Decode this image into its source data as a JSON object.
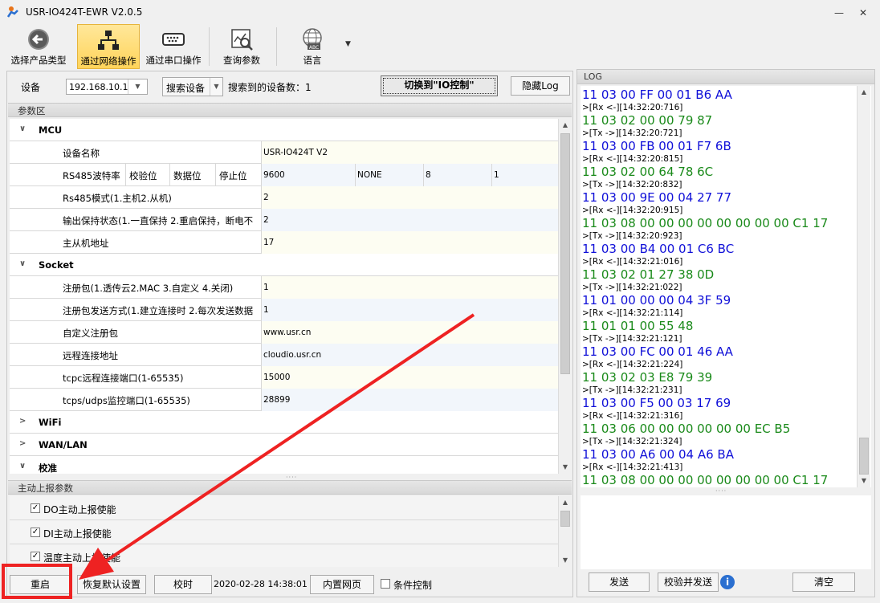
{
  "window": {
    "title": "USR-IO424T-EWR V2.0.5"
  },
  "toolbar": {
    "buttons": [
      {
        "label": "选择产品类型",
        "icon": "back-arrow-icon"
      },
      {
        "label": "通过网络操作",
        "icon": "network-icon",
        "active": true
      },
      {
        "label": "通过串口操作",
        "icon": "serial-port-icon"
      },
      {
        "label": "查询参数",
        "icon": "chart-search-icon"
      },
      {
        "label": "语言",
        "icon": "globe-abc-icon"
      }
    ]
  },
  "device_bar": {
    "device_label": "设备",
    "ip": "192.168.10.1",
    "search_button": "搜索设备",
    "found_count": "搜索到的设备数：1",
    "switch_button": "切换到\"IO控制\"",
    "hide_log_button": "隐藏Log"
  },
  "params": {
    "header": "参数区",
    "categories": {
      "mcu": "MCU",
      "socket": "Socket",
      "wifi": "WiFi",
      "wanlan": "WAN/LAN",
      "check": "校准"
    },
    "mcu_rows": [
      {
        "name": "设备名称",
        "value": "USR-IO424T V2"
      },
      {
        "name": "Rs485模式(1.主机2.从机)",
        "value": "2"
      },
      {
        "name": "输出保持状态(1.一直保持 2.重启保持，断电不",
        "value": "2"
      },
      {
        "name": "主从机地址",
        "value": "17"
      }
    ],
    "rs485": {
      "cols": [
        "RS485波特率",
        "校验位",
        "数据位",
        "停止位"
      ],
      "vals": [
        "9600",
        "NONE",
        "8",
        "1"
      ]
    },
    "socket_rows": [
      {
        "name": "注册包(1.透传云2.MAC 3.自定义 4.关闭)",
        "value": "1"
      },
      {
        "name": "注册包发送方式(1.建立连接时 2.每次发送数据",
        "value": "1"
      },
      {
        "name": "自定义注册包",
        "value": "www.usr.cn"
      },
      {
        "name": "远程连接地址",
        "value": "cloudio.usr.cn"
      },
      {
        "name": "tcpc远程连接端口(1-65535)",
        "value": "15000"
      },
      {
        "name": "tcps/udps监控端口(1-65535)",
        "value": "28899"
      }
    ]
  },
  "report": {
    "header": "主动上报参数",
    "items": [
      {
        "label": "DO主动上报使能",
        "checked": true
      },
      {
        "label": "DI主动上报使能",
        "checked": true
      },
      {
        "label": "温度主动上报使能",
        "checked": true
      }
    ]
  },
  "bottom": {
    "restart": "重启",
    "restore": "恢复默认设置",
    "sync_time": "校时",
    "datetime": "2020-02-28 14:38:01 5",
    "web": "内置网页",
    "cond_label": "条件控制"
  },
  "log": {
    "header": "LOG",
    "lines": [
      {
        "kind": "tx",
        "text": "11 03 00 FF 00 01 B6 AA"
      },
      {
        "kind": "ts",
        "text": ">[Rx <-][14:32:20:716]"
      },
      {
        "kind": "rx",
        "text": "11 03 02 00 00 79 87"
      },
      {
        "kind": "ts",
        "text": ">[Tx ->][14:32:20:721]"
      },
      {
        "kind": "tx",
        "text": "11 03 00 FB 00 01 F7 6B"
      },
      {
        "kind": "ts",
        "text": ">[Rx <-][14:32:20:815]"
      },
      {
        "kind": "rx",
        "text": "11 03 02 00 64 78 6C"
      },
      {
        "kind": "ts",
        "text": ">[Tx ->][14:32:20:832]"
      },
      {
        "kind": "tx",
        "text": "11 03 00 9E 00 04 27 77"
      },
      {
        "kind": "ts",
        "text": ">[Rx <-][14:32:20:915]"
      },
      {
        "kind": "rx",
        "text": "11 03 08 00 00 00 00 00 00 00 00 C1 17"
      },
      {
        "kind": "ts",
        "text": ">[Tx ->][14:32:20:923]"
      },
      {
        "kind": "tx",
        "text": "11 03 00 B4 00 01 C6 BC"
      },
      {
        "kind": "ts",
        "text": ">[Rx <-][14:32:21:016]"
      },
      {
        "kind": "rx",
        "text": "11 03 02 01 27 38 0D"
      },
      {
        "kind": "ts",
        "text": ">[Tx ->][14:32:21:022]"
      },
      {
        "kind": "tx",
        "text": "11 01 00 00 00 04 3F 59"
      },
      {
        "kind": "ts",
        "text": ">[Rx <-][14:32:21:114]"
      },
      {
        "kind": "rx",
        "text": "11 01 01 00 55 48"
      },
      {
        "kind": "ts",
        "text": ">[Tx ->][14:32:21:121]"
      },
      {
        "kind": "tx",
        "text": "11 03 00 FC 00 01 46 AA"
      },
      {
        "kind": "ts",
        "text": ">[Rx <-][14:32:21:224]"
      },
      {
        "kind": "rx",
        "text": "11 03 02 03 E8 79 39"
      },
      {
        "kind": "ts",
        "text": ">[Tx ->][14:32:21:231]"
      },
      {
        "kind": "tx",
        "text": "11 03 00 F5 00 03 17 69"
      },
      {
        "kind": "ts",
        "text": ">[Rx <-][14:32:21:316]"
      },
      {
        "kind": "rx",
        "text": "11 03 06 00 00 00 00 00 00 EC B5"
      },
      {
        "kind": "ts",
        "text": ">[Tx ->][14:32:21:324]"
      },
      {
        "kind": "tx",
        "text": "11 03 00 A6 00 04 A6 BA"
      },
      {
        "kind": "ts",
        "text": ">[Rx <-][14:32:21:413]"
      },
      {
        "kind": "rx",
        "text": "11 03 08 00 00 00 00 00 00 00 00 C1 17"
      }
    ],
    "send": "发送",
    "verify_send": "校验并发送",
    "clear": "清空"
  },
  "colors": {
    "annotation_red": "#ee2222",
    "tx_text": "#1010d8",
    "rx_text": "#1a8a1a",
    "active_tab": "#ffd45a"
  }
}
